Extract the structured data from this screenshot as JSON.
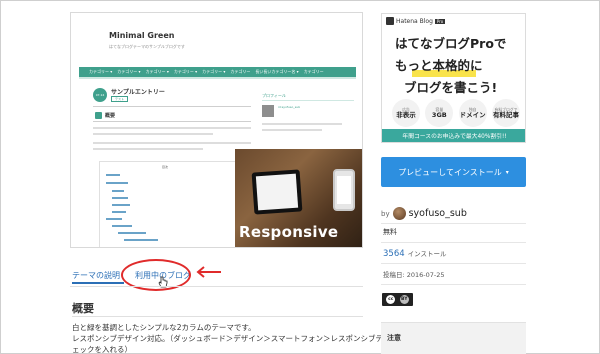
{
  "preview": {
    "blog_title": "Minimal Green",
    "blog_subtitle": "はてなブログテーマのサンプルブログです",
    "nav_items": [
      "カテゴリー ▾",
      "カテゴリー ▾",
      "カテゴリー ▾",
      "カテゴリー ▾",
      "カテゴリー ▾",
      "カテゴリー",
      "長い長いカテゴリー名 ▾",
      "カテゴリー"
    ],
    "date_badge": "07.14",
    "entry_title": "サンプルエントリー",
    "entry_tag": "テスト",
    "heading": "概要",
    "toc_heading": "目次",
    "sidebar_label": "プロフィール",
    "sidebar_user": "id:syofuso_sub",
    "responsive_label": "Responsive"
  },
  "tabs": {
    "theme_description": "テーマの説明",
    "blogs_using": "利用中のブログ"
  },
  "overview": {
    "title": "概要",
    "lines": [
      "白と緑を基調としたシンプルな2カラムのテーマです。",
      "レスポンシブデザイン対応。（ダッシュボード＞デザイン＞スマートフォン＞レスポンシブデザインにチ",
      "ェックを入れる）"
    ]
  },
  "ad": {
    "logo_text": "Hatena Blog",
    "logo_badge": "Pro",
    "line1": "はてなブログProで",
    "line2": "もっと本格的に",
    "line3": "ブログを書こう!",
    "badges": [
      {
        "top": "広告",
        "main": "非表示"
      },
      {
        "top": "容量",
        "main": "3GB"
      },
      {
        "top": "独自",
        "main": "ドメイン"
      },
      {
        "top": "有料ブログで",
        "main": "有料記事"
      }
    ],
    "banner": "年間コースのお申込みで最大40%割引!!"
  },
  "sidebar": {
    "install_button": "プレビューしてインストール",
    "install_caret": "▾",
    "by_label": "by",
    "author": "syofuso_sub",
    "price": "無料",
    "installs_count": "3564",
    "installs_label": "インストール",
    "posted": "投稿日: 2016-07-25",
    "license_cc": "cc",
    "license_by": "BY",
    "notes_label": "注意"
  },
  "colors": {
    "accent_green": "#3fa08c",
    "link_blue": "#2b6fb6",
    "button_blue": "#2d8fe0",
    "annotation_red": "#e02b2b"
  }
}
